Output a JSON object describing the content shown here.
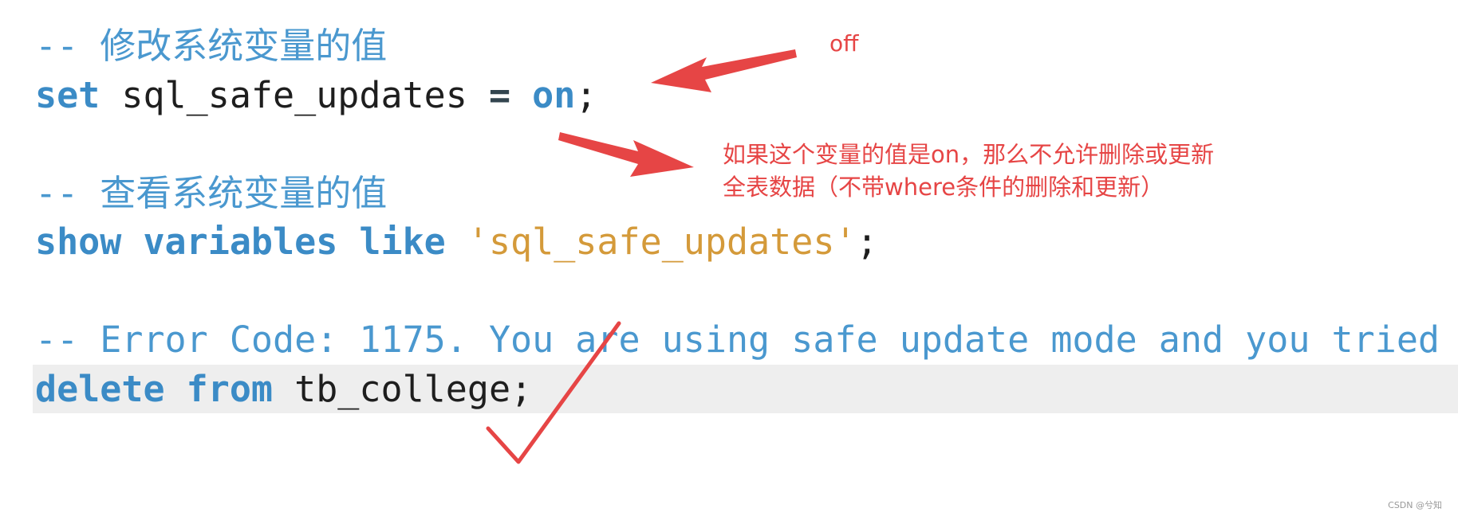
{
  "code_lines": {
    "l1_comment": "-- 修改系统变量的值",
    "l2_kw": "set",
    "l2_var": " sql_safe_updates ",
    "l2_op": "=",
    "l2_val": "on",
    "l2_end": ";",
    "l4_comment": "-- 查看系统变量的值",
    "l5_kw1": "show",
    "l5_kw2": "variables",
    "l5_kw3": "like",
    "l5_str": "'sql_safe_updates'",
    "l5_end": ";",
    "l7_comment": "-- Error Code: 1175. You are using safe update mode and you tried",
    "l8_kw1": "delete",
    "l8_kw2": "from",
    "l8_rest": " tb_college;"
  },
  "annotations": {
    "off_label": "off",
    "note_line1": "如果这个变量的值是on，那么不允许删除或更新",
    "note_line2": "全表数据（不带where条件的删除和更新）",
    "color": "#e64545"
  },
  "watermark": "CSDN @兮知",
  "colors": {
    "keyword": "#3b8bc6",
    "comment": "#4a98cf",
    "string": "#d49a3a",
    "highlight": "#eeeeee"
  }
}
